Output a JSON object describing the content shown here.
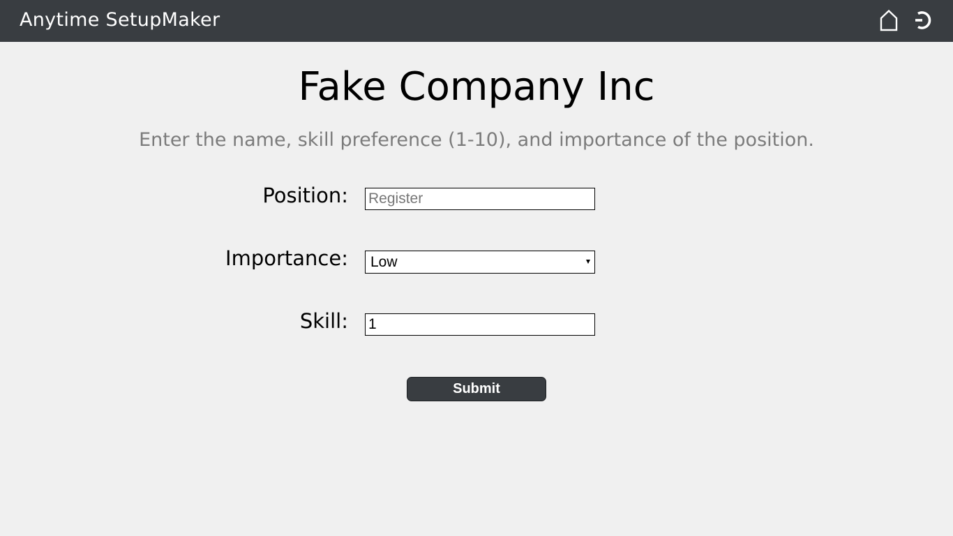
{
  "header": {
    "app_title": "Anytime SetupMaker",
    "home_icon": "home-icon",
    "logout_icon": "logout-icon",
    "background_color": "#393d41"
  },
  "main": {
    "company_title": "Fake Company Inc",
    "instructions": "Enter the name, skill preference (1-10), and importance of the position."
  },
  "form": {
    "position": {
      "label": "Position:",
      "value": "",
      "placeholder": "Register"
    },
    "importance": {
      "label": "Importance:",
      "selected": "Low"
    },
    "skill": {
      "label": "Skill:",
      "value": "1"
    },
    "submit_label": "Submit"
  }
}
